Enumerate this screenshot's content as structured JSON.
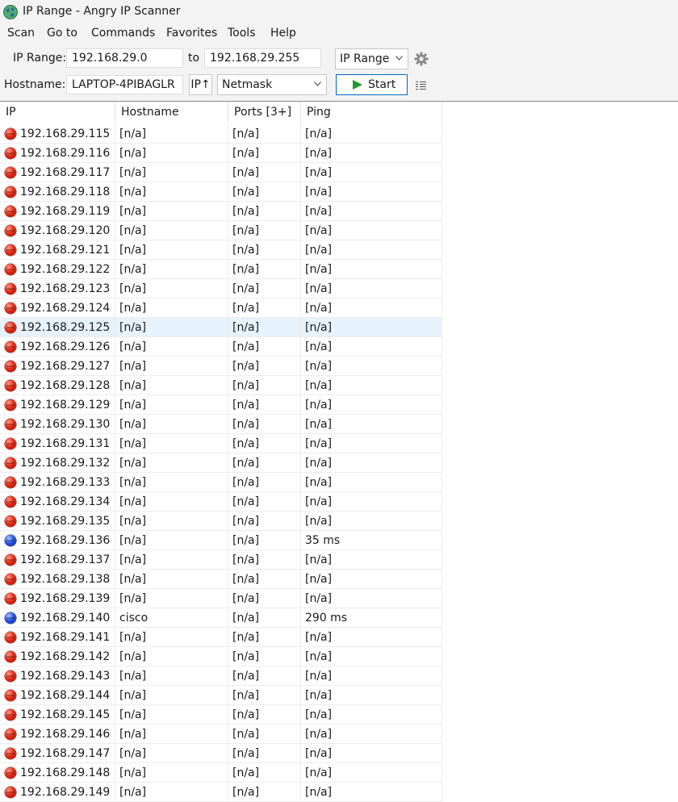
{
  "window": {
    "title": "IP Range - Angry IP Scanner"
  },
  "menu": [
    "Scan",
    "Go to",
    "Commands",
    "Favorites",
    "Tools",
    "Help"
  ],
  "toolbar": {
    "ip_range_label": "IP Range:",
    "ip_from": "192.168.29.0",
    "to_label": "to",
    "ip_to": "192.168.29.255",
    "feeder": "IP Range",
    "hostname_label": "Hostname:",
    "hostname": "LAPTOP-4PIBAGLR",
    "ip_up_label": "IP↑",
    "netmask": "Netmask",
    "start_label": "Start"
  },
  "table": {
    "columns": [
      "IP",
      "Hostname",
      "Ports [3+]",
      "Ping"
    ],
    "selected_ip": "192.168.29.125",
    "rows": [
      {
        "ip": "192.168.29.115",
        "host": "[n/a]",
        "ports": "[n/a]",
        "ping": "[n/a]",
        "status": "dead"
      },
      {
        "ip": "192.168.29.116",
        "host": "[n/a]",
        "ports": "[n/a]",
        "ping": "[n/a]",
        "status": "dead"
      },
      {
        "ip": "192.168.29.117",
        "host": "[n/a]",
        "ports": "[n/a]",
        "ping": "[n/a]",
        "status": "dead"
      },
      {
        "ip": "192.168.29.118",
        "host": "[n/a]",
        "ports": "[n/a]",
        "ping": "[n/a]",
        "status": "dead"
      },
      {
        "ip": "192.168.29.119",
        "host": "[n/a]",
        "ports": "[n/a]",
        "ping": "[n/a]",
        "status": "dead"
      },
      {
        "ip": "192.168.29.120",
        "host": "[n/a]",
        "ports": "[n/a]",
        "ping": "[n/a]",
        "status": "dead"
      },
      {
        "ip": "192.168.29.121",
        "host": "[n/a]",
        "ports": "[n/a]",
        "ping": "[n/a]",
        "status": "dead"
      },
      {
        "ip": "192.168.29.122",
        "host": "[n/a]",
        "ports": "[n/a]",
        "ping": "[n/a]",
        "status": "dead"
      },
      {
        "ip": "192.168.29.123",
        "host": "[n/a]",
        "ports": "[n/a]",
        "ping": "[n/a]",
        "status": "dead"
      },
      {
        "ip": "192.168.29.124",
        "host": "[n/a]",
        "ports": "[n/a]",
        "ping": "[n/a]",
        "status": "dead"
      },
      {
        "ip": "192.168.29.125",
        "host": "[n/a]",
        "ports": "[n/a]",
        "ping": "[n/a]",
        "status": "dead"
      },
      {
        "ip": "192.168.29.126",
        "host": "[n/a]",
        "ports": "[n/a]",
        "ping": "[n/a]",
        "status": "dead"
      },
      {
        "ip": "192.168.29.127",
        "host": "[n/a]",
        "ports": "[n/a]",
        "ping": "[n/a]",
        "status": "dead"
      },
      {
        "ip": "192.168.29.128",
        "host": "[n/a]",
        "ports": "[n/a]",
        "ping": "[n/a]",
        "status": "dead"
      },
      {
        "ip": "192.168.29.129",
        "host": "[n/a]",
        "ports": "[n/a]",
        "ping": "[n/a]",
        "status": "dead"
      },
      {
        "ip": "192.168.29.130",
        "host": "[n/a]",
        "ports": "[n/a]",
        "ping": "[n/a]",
        "status": "dead"
      },
      {
        "ip": "192.168.29.131",
        "host": "[n/a]",
        "ports": "[n/a]",
        "ping": "[n/a]",
        "status": "dead"
      },
      {
        "ip": "192.168.29.132",
        "host": "[n/a]",
        "ports": "[n/a]",
        "ping": "[n/a]",
        "status": "dead"
      },
      {
        "ip": "192.168.29.133",
        "host": "[n/a]",
        "ports": "[n/a]",
        "ping": "[n/a]",
        "status": "dead"
      },
      {
        "ip": "192.168.29.134",
        "host": "[n/a]",
        "ports": "[n/a]",
        "ping": "[n/a]",
        "status": "dead"
      },
      {
        "ip": "192.168.29.135",
        "host": "[n/a]",
        "ports": "[n/a]",
        "ping": "[n/a]",
        "status": "dead"
      },
      {
        "ip": "192.168.29.136",
        "host": "[n/a]",
        "ports": "[n/a]",
        "ping": "35 ms",
        "status": "alive"
      },
      {
        "ip": "192.168.29.137",
        "host": "[n/a]",
        "ports": "[n/a]",
        "ping": "[n/a]",
        "status": "dead"
      },
      {
        "ip": "192.168.29.138",
        "host": "[n/a]",
        "ports": "[n/a]",
        "ping": "[n/a]",
        "status": "dead"
      },
      {
        "ip": "192.168.29.139",
        "host": "[n/a]",
        "ports": "[n/a]",
        "ping": "[n/a]",
        "status": "dead"
      },
      {
        "ip": "192.168.29.140",
        "host": "cisco",
        "ports": "[n/a]",
        "ping": "290 ms",
        "status": "alive"
      },
      {
        "ip": "192.168.29.141",
        "host": "[n/a]",
        "ports": "[n/a]",
        "ping": "[n/a]",
        "status": "dead"
      },
      {
        "ip": "192.168.29.142",
        "host": "[n/a]",
        "ports": "[n/a]",
        "ping": "[n/a]",
        "status": "dead"
      },
      {
        "ip": "192.168.29.143",
        "host": "[n/a]",
        "ports": "[n/a]",
        "ping": "[n/a]",
        "status": "dead"
      },
      {
        "ip": "192.168.29.144",
        "host": "[n/a]",
        "ports": "[n/a]",
        "ping": "[n/a]",
        "status": "dead"
      },
      {
        "ip": "192.168.29.145",
        "host": "[n/a]",
        "ports": "[n/a]",
        "ping": "[n/a]",
        "status": "dead"
      },
      {
        "ip": "192.168.29.146",
        "host": "[n/a]",
        "ports": "[n/a]",
        "ping": "[n/a]",
        "status": "dead"
      },
      {
        "ip": "192.168.29.147",
        "host": "[n/a]",
        "ports": "[n/a]",
        "ping": "[n/a]",
        "status": "dead"
      },
      {
        "ip": "192.168.29.148",
        "host": "[n/a]",
        "ports": "[n/a]",
        "ping": "[n/a]",
        "status": "dead"
      },
      {
        "ip": "192.168.29.149",
        "host": "[n/a]",
        "ports": "[n/a]",
        "ping": "[n/a]",
        "status": "dead"
      }
    ]
  },
  "colors": {
    "dead": "#e32b16",
    "alive": "#2a55e0",
    "selection": "#e6f2fc",
    "start_icon": "#1f9b2a"
  },
  "icons": [
    "app-icon",
    "gear-icon",
    "chevron-down-icon",
    "play-icon",
    "columns-menu-icon"
  ]
}
